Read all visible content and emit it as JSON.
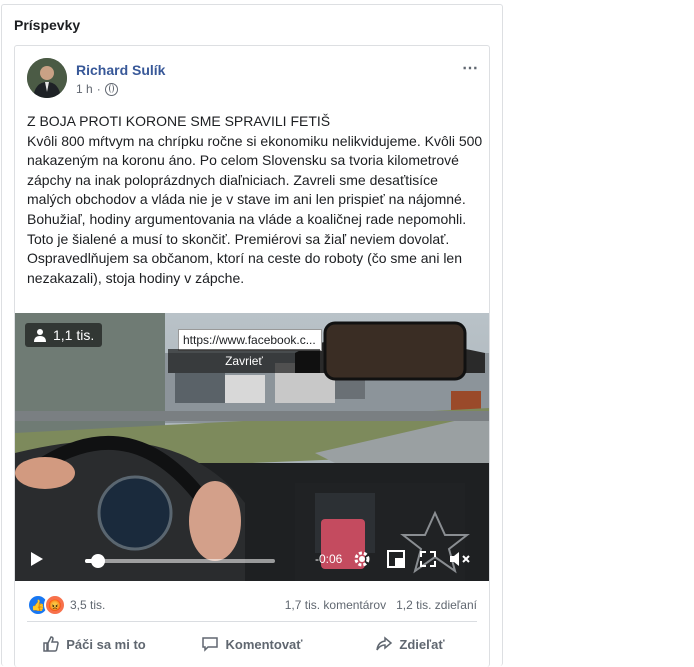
{
  "section": {
    "title": "Príspevky"
  },
  "post": {
    "author": "Richard Sulík",
    "time": "1 h",
    "paragraphs": [
      "Z BOJA PROTI KORONE SME SPRAVILI FETIŠ",
      "Kvôli 800 mŕtvym na chrípku ročne si ekonomiku nelikvidujeme. Kvôli 500 nakazeným na koronu áno. Po celom Slovensku sa tvoria kilometrové zápchy na inak poloprázdnych diaľniciach. Zavreli sme desaťtisíce malých obchodov a vláda nie je v stave im ani len prispieť na nájomné.",
      "Bohužiaľ, hodiny argumentovania na vláde a koaličnej rade nepomohli. Toto je šialené a musí to skončiť. Premiérovi sa žiaľ neviem dovolať. Ospravedlňujem sa občanom, ktorí na ceste do roboty (čo sme ani len nezakazali), stoja hodiny v zápche."
    ],
    "video": {
      "views": "1,1 tis.",
      "tooltip_url": "https://www.facebook.c...",
      "tooltip_close": "Zavrieť",
      "remaining": "-0:06",
      "progress": 0.07
    },
    "reactions": {
      "count": "3,5 tis.",
      "comments": "1,7 tis. komentárov",
      "shares": "1,2 tis. zdieľaní"
    },
    "actions": {
      "like": "Páči sa mi to",
      "comment": "Komentovať",
      "share": "Zdieľať"
    },
    "more_icon": "⋯"
  },
  "colors": {
    "link": "#385898",
    "like": "#1877f2",
    "angry": "#f7714c"
  }
}
